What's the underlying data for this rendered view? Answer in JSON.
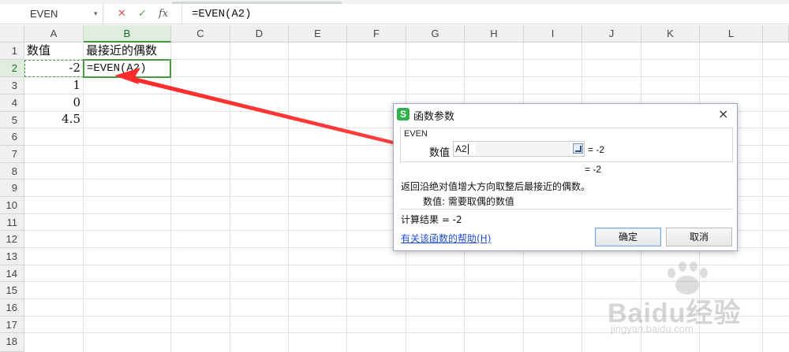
{
  "formula_bar": {
    "name_box": "EVEN",
    "cancel_icon": "✕",
    "enter_icon": "✓",
    "fx_icon": "fx",
    "formula": "=EVEN(A2)"
  },
  "grid": {
    "columns": [
      "A",
      "B",
      "C",
      "D",
      "E",
      "F",
      "G",
      "H",
      "I",
      "J",
      "K",
      "L"
    ],
    "rows": [
      "1",
      "2",
      "3",
      "4",
      "5",
      "6",
      "7",
      "8",
      "9",
      "10",
      "11",
      "12",
      "13",
      "14",
      "15",
      "16",
      "17",
      "18"
    ],
    "cells": {
      "A1": "数值",
      "B1": "最接近的偶数",
      "A2": "-2",
      "B2": "=EVEN(A2)",
      "A3": "1",
      "A4": "0",
      "A5": "4.5"
    },
    "active_cell": "B2",
    "selected_column": "B",
    "selected_row": "2"
  },
  "dialog": {
    "title": "函数参数",
    "logo": "S",
    "close_icon": "×",
    "function_name": "EVEN",
    "arg_label": "数值",
    "arg_value": "A2",
    "arg_result": "= -2",
    "formula_result": "= -2",
    "description": "返回沿绝对值增大方向取整后最接近的偶数。",
    "param_description": "数值: 需要取偶的数值",
    "calc_result": "计算结果 = -2",
    "help_link": "有关该函数的帮助(H)",
    "ok_label": "确定",
    "cancel_label": "取消"
  },
  "watermark": {
    "text": "Baidu经验",
    "sub": "jingyan.baidu.com"
  },
  "colors": {
    "selection_green": "#4a9a44",
    "header_selected_bg": "#dfeede",
    "arrow_red": "#ff2a2a",
    "link_blue": "#1f4fd6",
    "logo_green": "#2fb24b"
  }
}
